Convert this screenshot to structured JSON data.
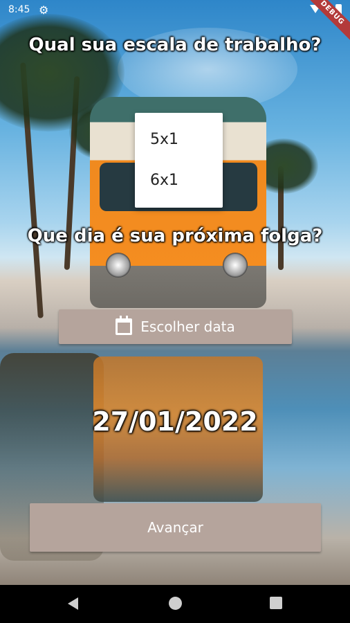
{
  "status_bar": {
    "time": "8:45",
    "debug_label": "DEBUG"
  },
  "main": {
    "question_work_schedule": "Qual sua escala de trabalho?",
    "schedule_dropdown": {
      "options": [
        "5x1",
        "6x1"
      ]
    },
    "question_next_day_off": "Que dia é sua próxima folga?",
    "choose_date_button": "Escolher data",
    "selected_date": "27/01/2022",
    "next_button": "Avançar"
  },
  "colors": {
    "button_background": "#b5a49c",
    "button_text": "#ffffff",
    "debug_banner": "#b33a3a"
  },
  "icons": {
    "settings": "gear-icon",
    "wifi": "wifi-icon",
    "battery": "battery-icon",
    "calendar": "calendar-icon",
    "back": "back-icon",
    "home": "home-icon",
    "recents": "recents-icon"
  }
}
